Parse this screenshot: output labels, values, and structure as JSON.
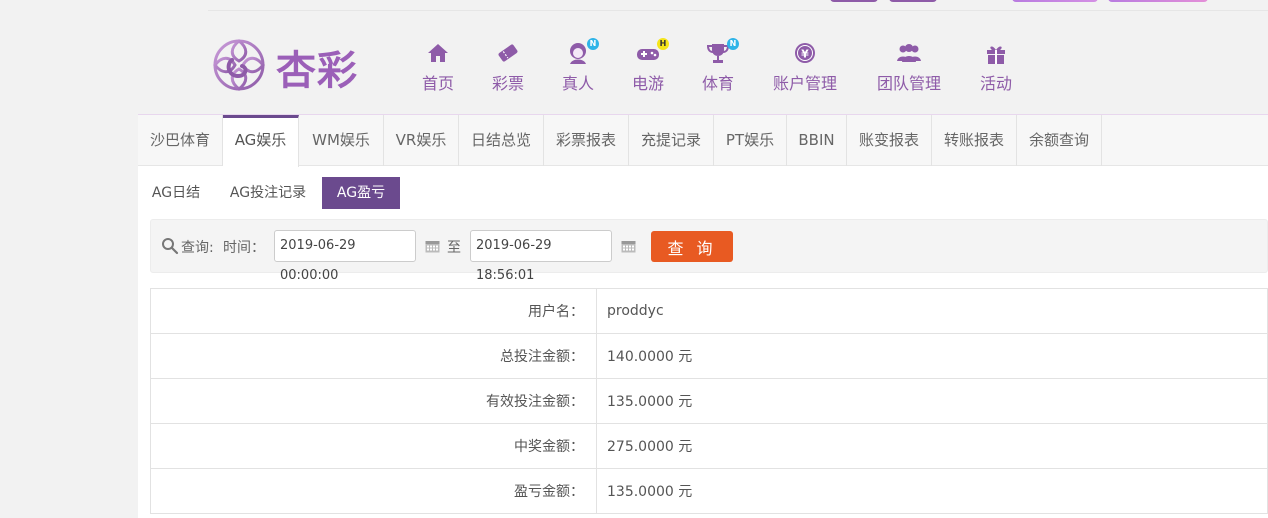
{
  "logo": {
    "text": "杏彩",
    "icon": "flower-logo-icon"
  },
  "nav": [
    {
      "label": "首页",
      "icon": "home-icon",
      "badge": ""
    },
    {
      "label": "彩票",
      "icon": "lottery-ticket-icon",
      "badge": ""
    },
    {
      "label": "真人",
      "icon": "live-dealer-icon",
      "badge": "N"
    },
    {
      "label": "电游",
      "icon": "gamepad-icon",
      "badge": "H"
    },
    {
      "label": "体育",
      "icon": "trophy-icon",
      "badge": "N"
    },
    {
      "label": "账户管理",
      "icon": "yen-coin-icon",
      "badge": ""
    },
    {
      "label": "团队管理",
      "icon": "team-icon",
      "badge": ""
    },
    {
      "label": "活动",
      "icon": "gift-icon",
      "badge": ""
    }
  ],
  "tabs": [
    "沙巴体育",
    "AG娱乐",
    "WM娱乐",
    "VR娱乐",
    "日结总览",
    "彩票报表",
    "充提记录",
    "PT娱乐",
    "BBIN",
    "账变报表",
    "转账报表",
    "余额查询"
  ],
  "active_tab": "AG娱乐",
  "subtabs": [
    "AG日结",
    "AG投注记录",
    "AG盈亏"
  ],
  "active_subtab": "AG盈亏",
  "query": {
    "label": "查询:",
    "time_label": "时间：",
    "start": "2019-06-29 00:00:00",
    "to": "至",
    "end": "2019-06-29 18:56:01",
    "button": "查 询"
  },
  "results": [
    {
      "label": "用户名：",
      "value": "proddyc"
    },
    {
      "label": "总投注金额：",
      "value": "140.0000 元"
    },
    {
      "label": "有效投注金额：",
      "value": "135.0000 元"
    },
    {
      "label": "中奖金额：",
      "value": "275.0000 元"
    },
    {
      "label": "盈亏金额：",
      "value": "135.0000 元"
    }
  ],
  "colors": {
    "brand": "#8e5ba8",
    "active": "#6b4a8e",
    "query_button": "#e85a22"
  }
}
